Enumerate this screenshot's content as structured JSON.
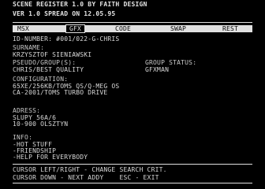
{
  "header": {
    "line1": "SCENE REGISTER 1.0 BY FAITH DESIGN",
    "line2": "VER 1.0 SPREAD ON 12.05.95"
  },
  "tabs": [
    {
      "label": "MSX",
      "active": false
    },
    {
      "label": "GFX",
      "active": true
    },
    {
      "label": "CODE",
      "active": false
    },
    {
      "label": "SWAP",
      "active": false
    },
    {
      "label": "REST",
      "active": false
    }
  ],
  "record": {
    "id_line": "ID-NUMBER: #001/022-G-CHRIS",
    "surname_label": "SURNAME:",
    "surname_value": "KRZYSZTOF SIENIAWSKI",
    "pseudo_label": "PSEUDO/GROUP(S):",
    "group_status_label": "GROUP STATUS:",
    "pseudo_value": "CHRIS/BEST QUALITY",
    "group_status_value": "GFXMAN",
    "config_label": "CONFIGURATION:",
    "config_line1": "65XE/256KB/TOMS QS/Q-MEG OS",
    "config_line2": "CA-2001/TOMS TURBO DRIVE",
    "address_label": "ADRESS:",
    "address_line1": "SLUPY 56A/6",
    "address_line2": "10-900 OLSZTYN",
    "info_label": "INFO:",
    "info_line1": "-HOT STUFF",
    "info_line2": "-FRIENDSHIP",
    "info_line3": "-HELP FOR EVERYBODY"
  },
  "footer": {
    "line1": "CURSOR LEFT/RIGHT - CHANGE SEARCH CRIT.",
    "line2": "CURSOR DOWN - NEXT ADDY    ESC - EXIT"
  }
}
